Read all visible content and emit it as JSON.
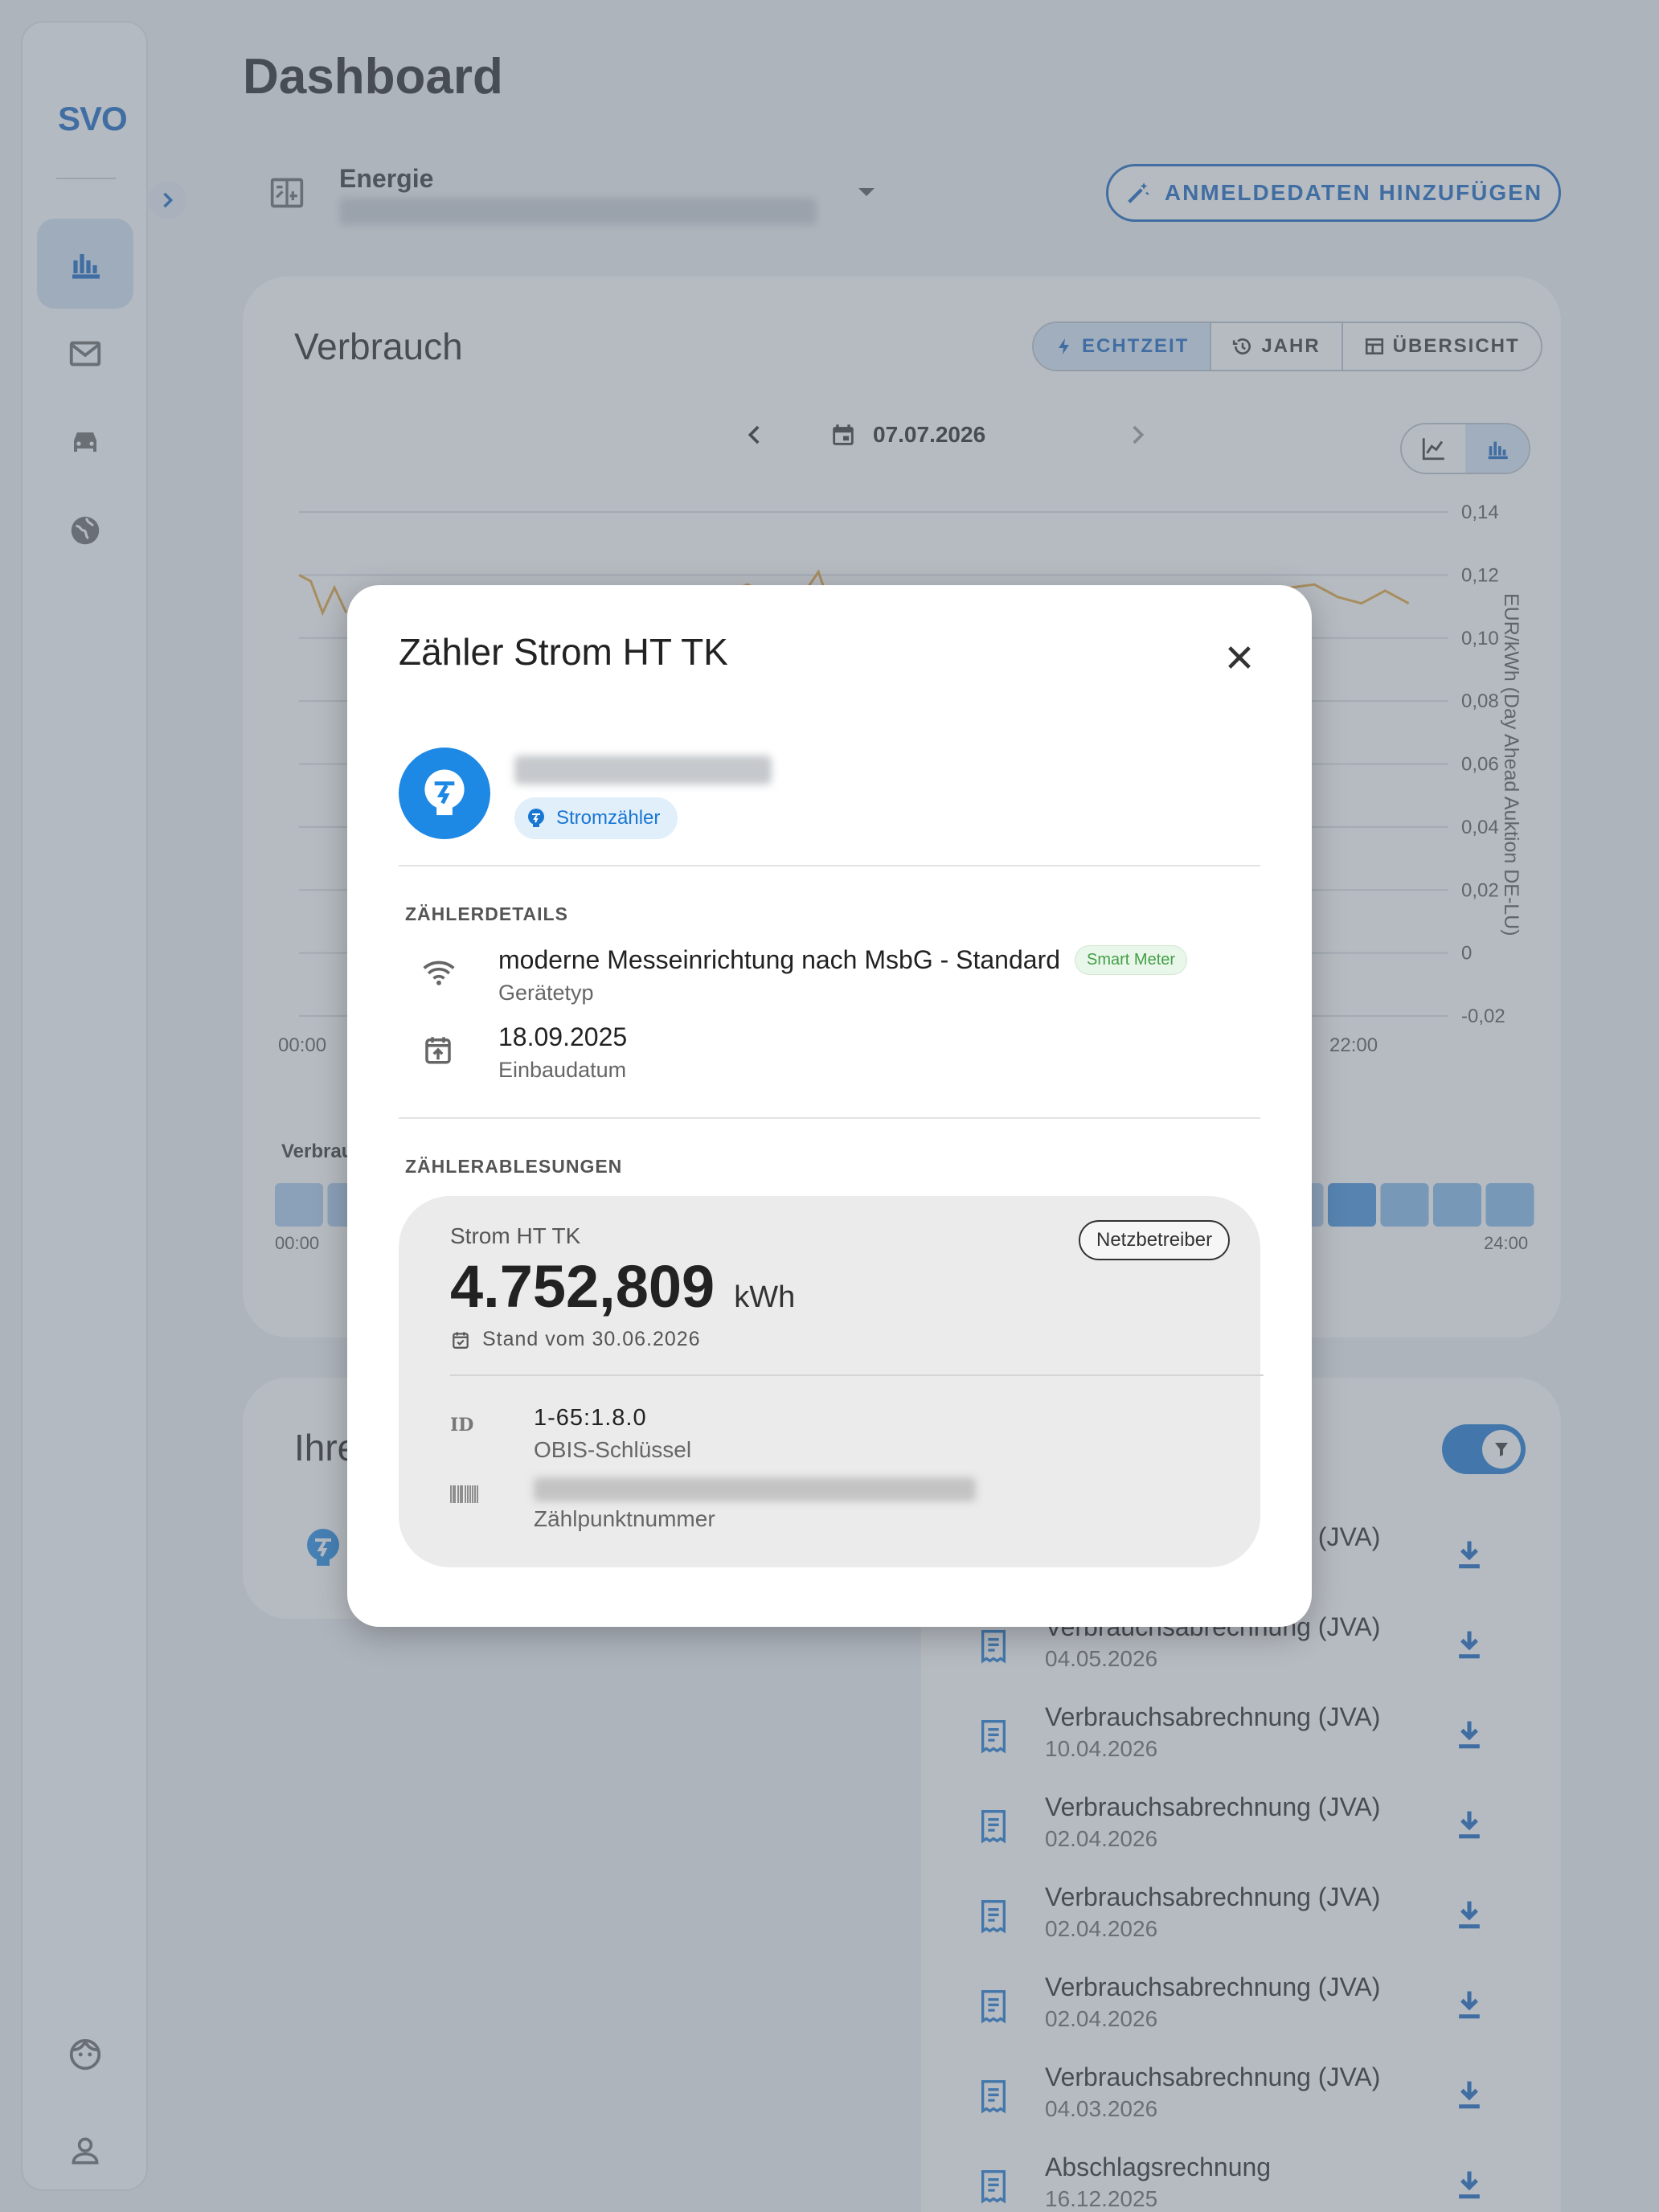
{
  "app": {
    "logo": "SVO"
  },
  "sidebar": {
    "items": [
      {
        "name": "charts",
        "icon": "bar-chart-icon",
        "active": true
      },
      {
        "name": "mail",
        "icon": "mail-icon",
        "active": false
      },
      {
        "name": "car",
        "icon": "car-icon",
        "active": false
      },
      {
        "name": "globe",
        "icon": "globe-icon",
        "active": false
      }
    ],
    "bottom_items": [
      {
        "name": "support",
        "icon": "face-icon"
      },
      {
        "name": "account",
        "icon": "person-icon"
      }
    ]
  },
  "header": {
    "title": "Dashboard"
  },
  "contract": {
    "label": "Energie",
    "add_credentials_label": "ANMELDEDATEN HINZUFÜGEN"
  },
  "verbrauch": {
    "title": "Verbrauch",
    "tabs": [
      {
        "label": "ECHTZEIT",
        "icon": "bolt-icon",
        "active": true
      },
      {
        "label": "JAHR",
        "icon": "history-icon",
        "active": false
      },
      {
        "label": "ÜBERSICHT",
        "icon": "table-icon",
        "active": false
      }
    ],
    "date": "07.07.2026",
    "time_labels": {
      "start": "00:00",
      "end": "22:00"
    },
    "axis_ticks": [
      "0,14",
      "0,12",
      "0,10",
      "0,08",
      "0,06",
      "0,04",
      "0,02",
      "0",
      "-0,02"
    ],
    "y_axis_label": "EUR/kWh (Day Ahead Auktion DE-LU)",
    "strip_label": "Verbrau",
    "strip_start": "00:00",
    "strip_end": "24:00"
  },
  "chart_data": {
    "type": "line",
    "ylabel": "EUR/kWh (Day Ahead Auktion DE-LU)",
    "ylim": [
      -0.02,
      0.14
    ],
    "series": [
      {
        "name": "EUR/kWh (Day Ahead Auktion DE-LU)",
        "color": "#e0a33a",
        "visible_segments": [
          {
            "x": [
              "00:00",
              "00:15",
              "00:30",
              "00:45",
              "01:00"
            ],
            "y": [
              0.12,
              0.118,
              0.108,
              0.116,
              0.108
            ]
          },
          {
            "x": [
              "08:00",
              "08:30",
              "09:00",
              "09:30",
              "10:00",
              "10:30",
              "11:00",
              "11:15",
              "11:30"
            ],
            "y": [
              0.11,
              0.112,
              0.114,
              0.117,
              0.113,
              0.11,
              0.121,
              0.11,
              0.112
            ]
          },
          {
            "x": [
              "19:30",
              "20:00",
              "20:30",
              "21:00",
              "21:30",
              "22:00",
              "22:30",
              "23:00",
              "23:30"
            ],
            "y": [
              0.11,
              0.112,
              0.113,
              0.116,
              0.117,
              0.113,
              0.111,
              0.115,
              0.111
            ]
          }
        ]
      }
    ]
  },
  "ihre": {
    "title": "Ihre"
  },
  "documents": {
    "items": [
      {
        "title": "Verbrauchsabrechnung (JVA)",
        "date": ""
      },
      {
        "title": "Verbrauchsabrechnung (JVA)",
        "date": "04.05.2026"
      },
      {
        "title": "Verbrauchsabrechnung (JVA)",
        "date": "10.04.2026"
      },
      {
        "title": "Verbrauchsabrechnung (JVA)",
        "date": "02.04.2026"
      },
      {
        "title": "Verbrauchsabrechnung (JVA)",
        "date": "02.04.2026"
      },
      {
        "title": "Verbrauchsabrechnung (JVA)",
        "date": "02.04.2026"
      },
      {
        "title": "Verbrauchsabrechnung (JVA)",
        "date": "04.03.2026"
      },
      {
        "title": "Abschlagsrechnung",
        "date": "16.12.2025"
      }
    ]
  },
  "modal": {
    "title": "Zähler Strom HT TK",
    "type_chip": "Stromzähler",
    "details_label": "ZÄHLERDETAILS",
    "device_type": "moderne Messeinrichtung nach MsbG - Standard",
    "device_type_badge": "Smart Meter",
    "device_type_label": "Gerätetyp",
    "install_date": "18.09.2025",
    "install_date_label": "Einbaudatum",
    "readings_label": "ZÄHLERABLESUNGEN",
    "reading": {
      "name": "Strom HT TK",
      "source": "Netzbetreiber",
      "value": "4.752,809",
      "unit": "kWh",
      "date_text": "Stand vom 30.06.2026",
      "obis_value": "1-65:1.8.0",
      "obis_label": "OBIS-Schlüssel",
      "zpn_label": "Zählpunktnummer",
      "id_icon_text": "ID"
    }
  },
  "colors": {
    "primary": "#1565c0",
    "chart_line": "#e0a33a",
    "smart_meter": "#43a047"
  }
}
